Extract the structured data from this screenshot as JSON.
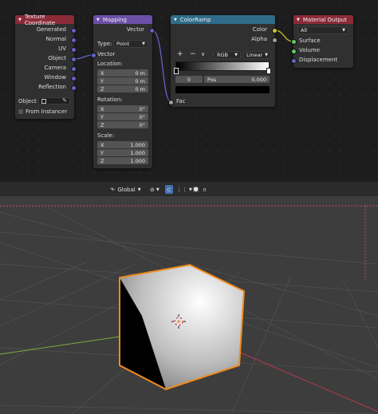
{
  "texture_coordinate": {
    "title": "Texture Coordinate",
    "outputs": [
      "Generated",
      "Normal",
      "UV",
      "Object",
      "Camera",
      "Window",
      "Reflection"
    ],
    "object_label": "Object",
    "from_instancer_label": "From Instancer"
  },
  "mapping": {
    "title": "Mapping",
    "output": "Vector",
    "type_label": "Type:",
    "type_value": "Point",
    "input_vector": "Vector",
    "location_label": "Location:",
    "location": [
      {
        "axis": "X",
        "value": "0 m"
      },
      {
        "axis": "Y",
        "value": "0 m"
      },
      {
        "axis": "Z",
        "value": "0 m"
      }
    ],
    "rotation_label": "Rotation:",
    "rotation": [
      {
        "axis": "X",
        "value": "0°"
      },
      {
        "axis": "Y",
        "value": "0°"
      },
      {
        "axis": "Z",
        "value": "0°"
      }
    ],
    "scale_label": "Scale:",
    "scale": [
      {
        "axis": "X",
        "value": "1.000"
      },
      {
        "axis": "Y",
        "value": "1.000"
      },
      {
        "axis": "Z",
        "value": "1.000"
      }
    ]
  },
  "color_ramp": {
    "title": "ColorRamp",
    "out_color": "Color",
    "out_alpha": "Alpha",
    "add_symbol": "+",
    "remove_symbol": "−",
    "menu_symbol": "∨",
    "color_mode": "RGB",
    "interpolation": "Linear",
    "stop_index": "0",
    "pos_label": "Pos",
    "pos_value": "0.000",
    "input_fac": "Fac",
    "stop_color": "#000000"
  },
  "material_output": {
    "title": "Material Output",
    "target": "All",
    "inputs": [
      "Surface",
      "Volume",
      "Displacement"
    ]
  },
  "toolbar": {
    "orientation": "Global"
  },
  "colors": {
    "tex_coord_header": "#8b2b38",
    "mapping_header": "#6b4fa8",
    "color_ramp_header": "#2f6d8a",
    "material_output_header": "#8b2b38",
    "selection_outline": "#f08a1e",
    "x_axis": "#b53a4a",
    "y_axis": "#7cab3c",
    "viewport_bg": "#3d3d3d",
    "node_bg": "#303030"
  }
}
